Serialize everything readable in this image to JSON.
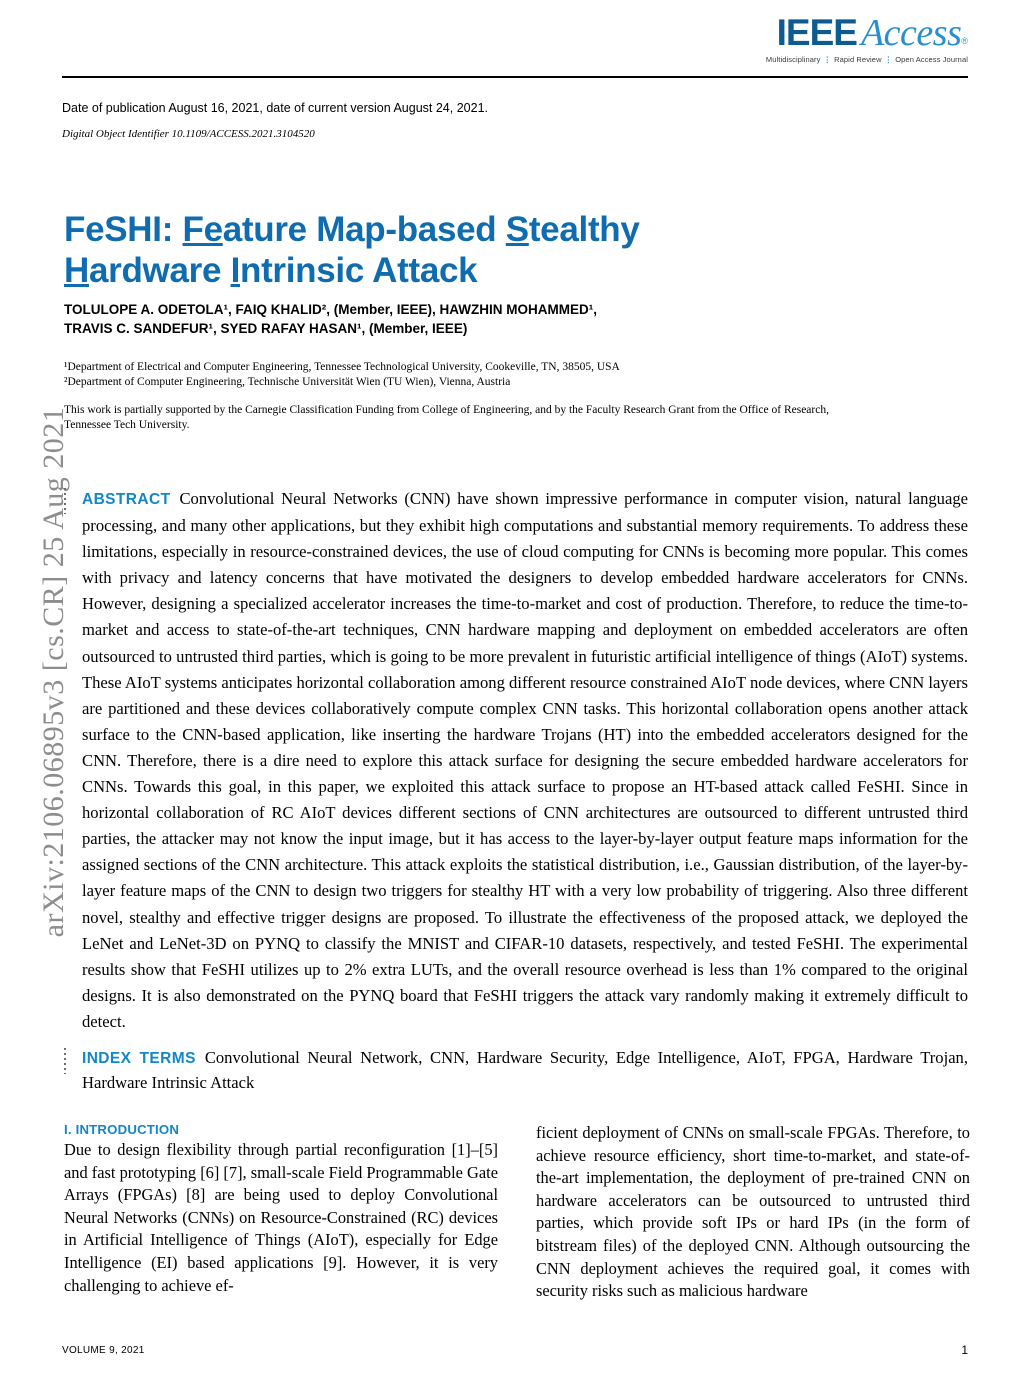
{
  "masthead": {
    "logo_ieee": "IEEE",
    "logo_access": "Access",
    "logo_tagline_1": "Multidisciplinary",
    "logo_tagline_2": "Rapid Review",
    "logo_tagline_3": "Open Access Journal"
  },
  "publication": {
    "date_line": "Date of publication August 16, 2021, date of current version August 24, 2021.",
    "doi_line": "Digital Object Identifier 10.1109/ACCESS.2021.3104520"
  },
  "arxiv": {
    "stamp": "arXiv:2106.06895v3  [cs.CR]  25 Aug 2021"
  },
  "title": {
    "line1_a": "FeSHI: ",
    "line1_u1": "Fe",
    "line1_b": "ature Map-based ",
    "line1_u2": "S",
    "line1_c": "tealthy",
    "line2_u1": "H",
    "line2_a": "ardware ",
    "line2_u2": "I",
    "line2_b": "ntrinsic Attack"
  },
  "authors": {
    "line1": "TOLULOPE A. ODETOLA¹, FAIQ KHALID², (Member, IEEE), HAWZHIN MOHAMMED¹,",
    "line2": "TRAVIS C. SANDEFUR¹, SYED RAFAY HASAN¹, (Member, IEEE)"
  },
  "affiliations": {
    "aff1": "¹Department of Electrical and Computer Engineering, Tennessee Technological University, Cookeville, TN, 38505, USA",
    "aff2": "²Department of Computer Engineering, Technische Universität Wien (TU Wien), Vienna, Austria",
    "funding": "This work is partially supported by the Carnegie Classification Funding from College of Engineering, and by the Faculty Research Grant from the Office of Research, Tennessee Tech University."
  },
  "abstract": {
    "kicker": "ABSTRACT",
    "text": "Convolutional Neural Networks (CNN) have shown impressive performance in computer vision, natural language processing, and many other applications, but they exhibit high computations and substantial memory requirements. To address these limitations, especially in resource-constrained devices, the use of cloud computing for CNNs is becoming more popular. This comes with privacy and latency concerns that have motivated the designers to develop embedded hardware accelerators for CNNs. However, designing a specialized accelerator increases the time-to-market and cost of production. Therefore, to reduce the time-to-market and access to state-of-the-art techniques, CNN hardware mapping and deployment on embedded accelerators are often outsourced to untrusted third parties, which is going to be more prevalent in futuristic artificial intelligence of things (AIoT) systems. These AIoT systems anticipates horizontal collaboration among different resource constrained AIoT node devices, where CNN layers are partitioned and these devices collaboratively compute complex CNN tasks. This horizontal collaboration opens another attack surface to the CNN-based application, like inserting the hardware Trojans (HT) into the embedded accelerators designed for the CNN. Therefore, there is a dire need to explore this attack surface for designing the secure embedded hardware accelerators for CNNs. Towards this goal, in this paper, we exploited this attack surface to propose an HT-based attack called FeSHI. Since in horizontal collaboration of RC AIoT devices different sections of CNN architectures are outsourced to different untrusted third parties, the attacker may not know the input image, but it has access to the layer-by-layer output feature maps information for the assigned sections of the CNN architecture. This attack exploits the statistical distribution, i.e., Gaussian distribution, of the layer-by-layer feature maps of the CNN to design two triggers for stealthy HT with a very low probability of triggering. Also three different novel, stealthy and effective trigger designs are proposed. To illustrate the effectiveness of the proposed attack, we deployed the LeNet and LeNet-3D on PYNQ to classify the MNIST and CIFAR-10 datasets, respectively, and tested FeSHI. The experimental results show that FeSHI utilizes up to 2% extra LUTs, and the overall resource overhead is less than 1% compared to the original designs. It is also demonstrated on the PYNQ board that FeSHI triggers the attack vary randomly making it extremely difficult to detect."
  },
  "index_terms": {
    "kicker": "INDEX TERMS",
    "text": "Convolutional Neural Network, CNN, Hardware Security, Edge Intelligence, AIoT, FPGA, Hardware Trojan, Hardware Intrinsic Attack"
  },
  "introduction": {
    "heading": "I. INTRODUCTION",
    "left_paragraph": "Due to design flexibility through partial reconfiguration [1]–[5] and fast prototyping [6] [7], small-scale Field Programmable Gate Arrays (FPGAs) [8] are being used to deploy Convolutional Neural Networks (CNNs) on Resource-Constrained (RC) devices in Artificial Intelligence of Things (AIoT), especially for Edge Intelligence (EI) based applications [9]. However, it is very challenging to achieve ef-",
    "right_paragraph": "ficient deployment of CNNs on small-scale FPGAs. Therefore, to achieve resource efficiency, short time-to-market, and state-of-the-art implementation, the deployment of pre-trained CNN on hardware accelerators can be outsourced to untrusted third parties, which provide soft IPs or hard IPs (in the form of bitstream files) of the deployed CNN. Although outsourcing the CNN deployment achieves the required goal, it comes with security risks such as malicious hardware"
  },
  "footer": {
    "volume": "VOLUME 9, 2021",
    "page_number": "1"
  },
  "colors": {
    "title_blue": "#0f6cae",
    "kicker_blue": "#1287c8",
    "logo_dark_blue": "#0d5b90",
    "logo_light_blue": "#2a8fce",
    "arxiv_gray": "#8d8d8d"
  }
}
